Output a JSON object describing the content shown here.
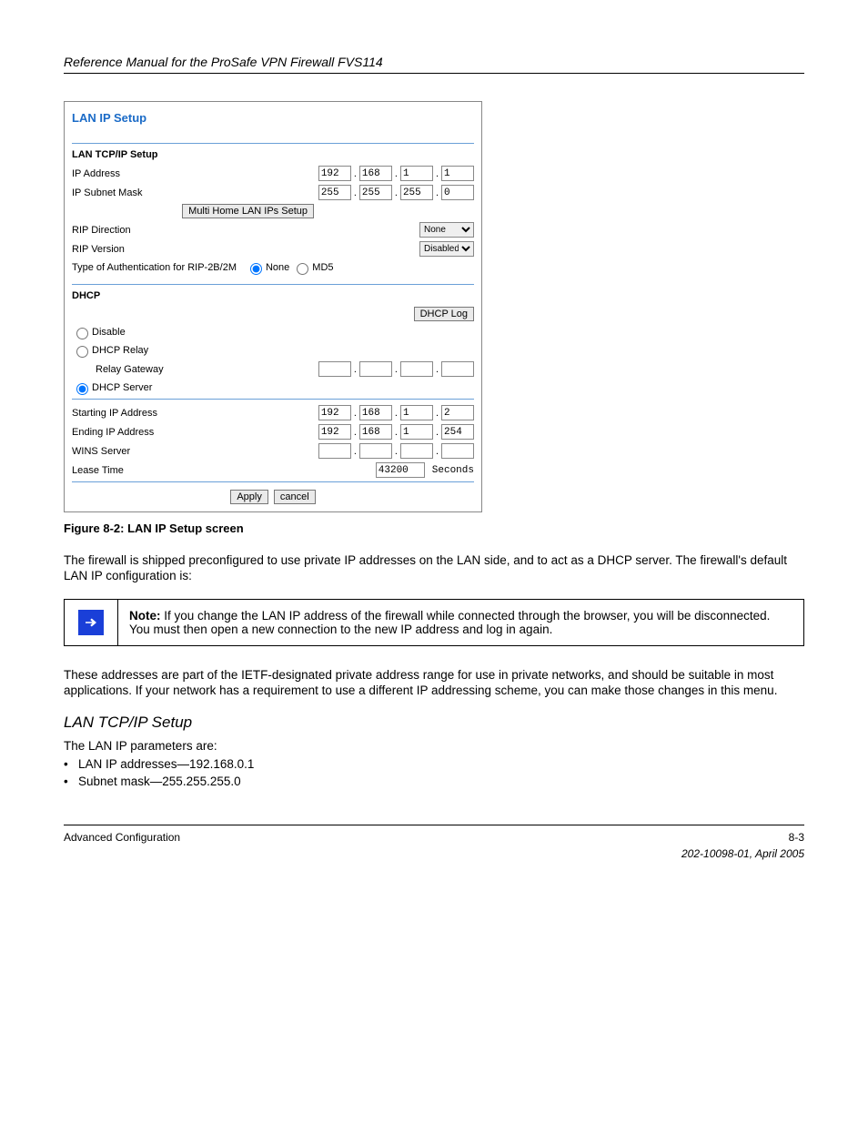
{
  "header_text": "Reference Manual for the ProSafe VPN Firewall FVS114",
  "screenshot": {
    "title": "LAN IP Setup",
    "section1": "LAN TCP/IP Setup",
    "ip_address_label": "IP Address",
    "ip_address": [
      "192",
      "168",
      "1",
      "1"
    ],
    "subnet_label": "IP Subnet Mask",
    "subnet": [
      "255",
      "255",
      "255",
      "0"
    ],
    "multi_home_btn": "Multi Home LAN IPs Setup",
    "rip_dir_label": "RIP Direction",
    "rip_dir_value": "None",
    "rip_ver_label": "RIP Version",
    "rip_ver_value": "Disabled",
    "auth_label": "Type of Authentication for RIP-2B/2M",
    "auth_opt_none": "None",
    "auth_opt_md5": "MD5",
    "section2": "DHCP",
    "dhcp_log_btn": "DHCP Log",
    "opt_disable": "Disable",
    "opt_relay": "DHCP Relay",
    "relay_gw_label": "Relay Gateway",
    "relay_gw": [
      "",
      "",
      "",
      ""
    ],
    "opt_server": "DHCP Server",
    "start_ip_label": "Starting IP Address",
    "start_ip": [
      "192",
      "168",
      "1",
      "2"
    ],
    "end_ip_label": "Ending IP Address",
    "end_ip": [
      "192",
      "168",
      "1",
      "254"
    ],
    "wins_label": "WINS Server",
    "wins": [
      "",
      "",
      "",
      ""
    ],
    "lease_label": "Lease Time",
    "lease_value": "43200",
    "lease_units": "Seconds",
    "apply_btn": "Apply",
    "cancel_btn": "cancel"
  },
  "figure_caption": "Figure 8-2:   LAN IP Setup screen",
  "para1": "The firewall is shipped preconfigured to use private IP addresses on the LAN side, and to act as a DHCP server. The firewall's default LAN IP configuration is:",
  "bullets": {
    "ip": "LAN IP addresses—192.168.0.1",
    "mask": "Subnet mask—255.255.255.0"
  },
  "note": {
    "bold": "Note: ",
    "text": "If you change the LAN IP address of the firewall while connected through the browser, you will be disconnected. You must then open a new connection to the new IP address and log in again."
  },
  "para2": "These addresses are part of the IETF-designated private address range for use in private networks, and should be suitable in most applications. If your network has a requirement to use a different IP addressing scheme, you can make those changes in this menu.",
  "h2": "LAN TCP/IP Setup",
  "para3": "The LAN IP parameters are:",
  "footer_left": "Advanced Configuration",
  "footer_page": "8-3",
  "footer_right": "202-10098-01, April 2005"
}
